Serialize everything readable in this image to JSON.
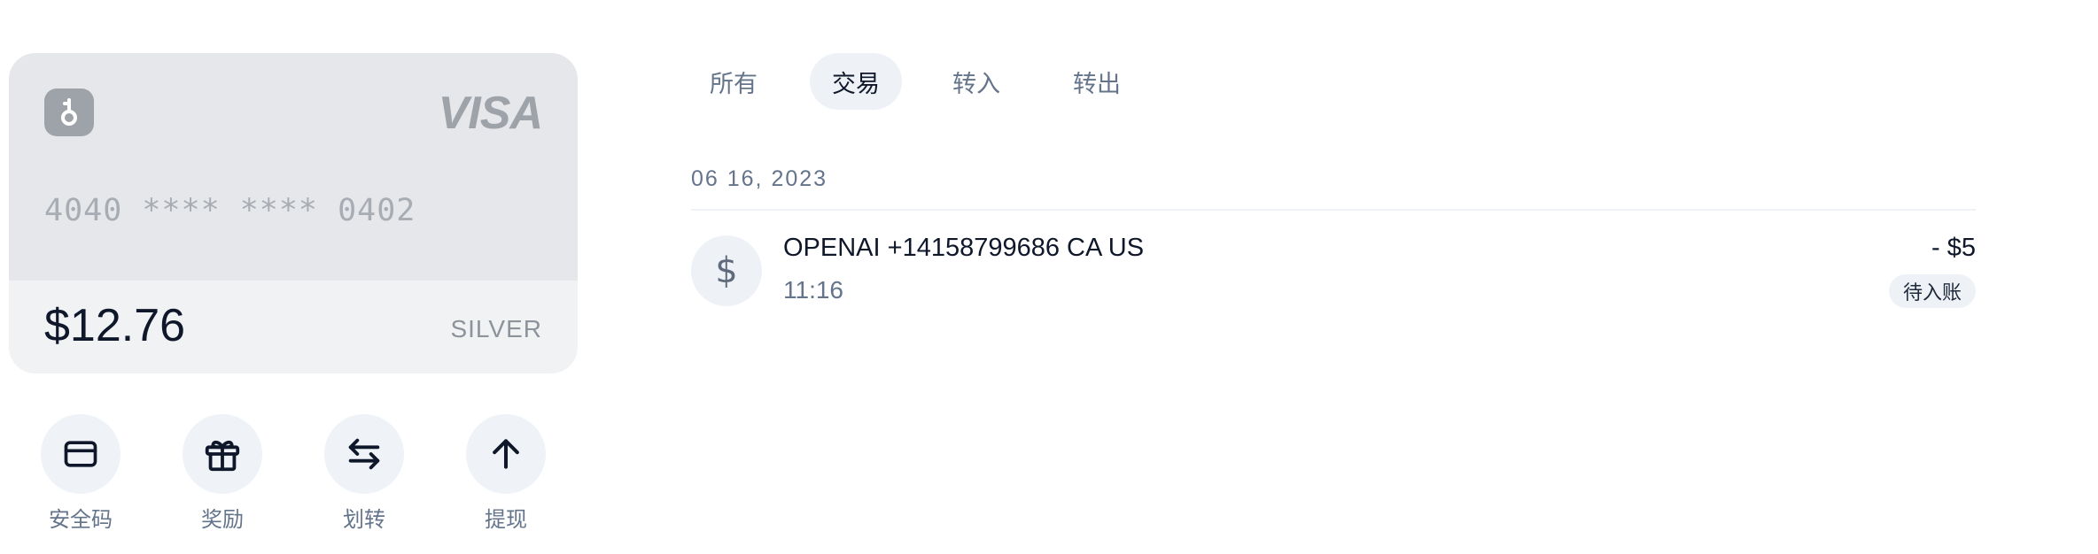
{
  "card": {
    "brand": "VISA",
    "number": "4040 **** **** 0402",
    "balance": "$12.76",
    "tier": "SILVER",
    "logo_icon": "wallet-key-icon"
  },
  "actions": [
    {
      "label": "安全码",
      "icon": "credit-card-icon"
    },
    {
      "label": "奖励",
      "icon": "gift-icon"
    },
    {
      "label": "划转",
      "icon": "transfer-arrows-icon"
    },
    {
      "label": "提现",
      "icon": "arrow-up-icon"
    }
  ],
  "tabs": [
    {
      "label": "所有",
      "active": false
    },
    {
      "label": "交易",
      "active": true
    },
    {
      "label": "转入",
      "active": false
    },
    {
      "label": "转出",
      "active": false
    }
  ],
  "transactions": {
    "date": "06 16, 2023",
    "items": [
      {
        "icon": "dollar-icon",
        "icon_glyph": "$",
        "title": "OPENAI +14158799686 CA US",
        "time": "11:16",
        "amount": "- $5",
        "status": "待入账"
      }
    ]
  },
  "colors": {
    "accent_bg": "#eef2f7",
    "text_primary": "#0f172a",
    "text_muted": "#64748b"
  }
}
